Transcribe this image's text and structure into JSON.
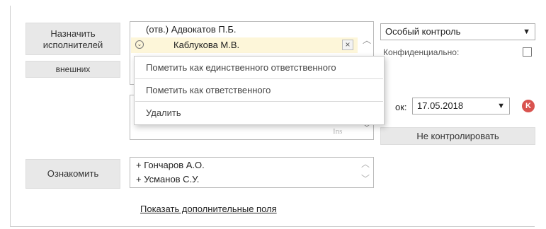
{
  "executors": {
    "assign_label": "Назначить исполнителей",
    "external_label": "внешних",
    "list": [
      {
        "prefix": "(отв.)",
        "name": "Адвокатов П.Б."
      },
      {
        "prefix": "",
        "name": "Каблукова М.В."
      }
    ],
    "remove_glyph": "×"
  },
  "context_menu": {
    "items": [
      "Пометить как единственного ответственного",
      "Пометить как ответственного",
      "Удалить"
    ]
  },
  "second_list": {
    "ins_label": "Ins"
  },
  "control": {
    "select_value": "Особый контроль",
    "confidential_label": "Конфиденциально:",
    "confidential_checked": false,
    "deadline_label": "ок:",
    "deadline_value": "17.05.2018",
    "badge_letter": "K",
    "no_control_label": "Не контролировать"
  },
  "acquaint": {
    "button_label": "Ознакомить",
    "list": [
      "+ Гончаров А.О.",
      "+ Усманов С.У."
    ]
  },
  "more_fields_link": "Показать дополнительные поля",
  "colors": {
    "highlight_row": "#fdf6d9",
    "badge": "#d9534f",
    "button_bg": "#e8e8e8"
  }
}
